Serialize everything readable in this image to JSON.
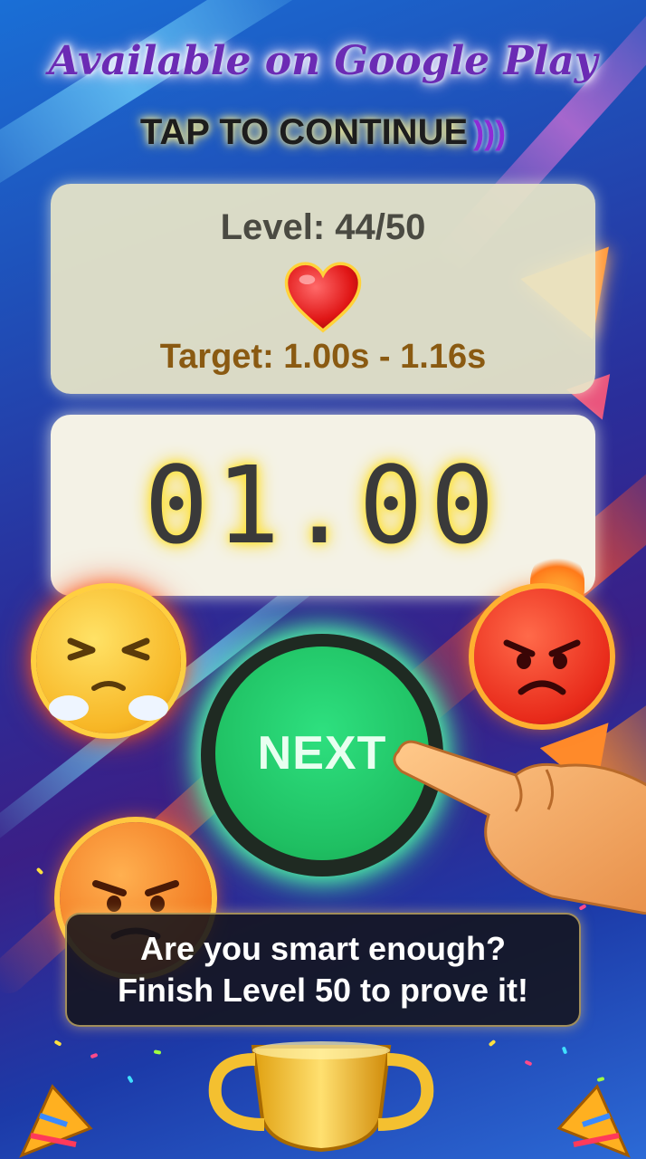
{
  "banner": {
    "headline": "Available on Google Play",
    "tap_prompt": "TAP TO CONTINUE",
    "tap_icon": "sound-waves-icon"
  },
  "level_panel": {
    "level_text": "Level: 44/50",
    "life_icon": "heart-icon",
    "target_text": "Target: 1.00s - 1.16s"
  },
  "timer": {
    "value": "01.00"
  },
  "action": {
    "next_label": "NEXT"
  },
  "promo": {
    "line1": "Are you smart enough?",
    "line2": "Finish Level 50 to prove it!"
  },
  "decorations": {
    "emojis": [
      "huffing-emoji",
      "angry-fire-emoji",
      "grumpy-emoji"
    ],
    "hand_icon": "pointing-hand-icon",
    "trophy_icon": "trophy-icon",
    "popper_icon": "party-popper-icon"
  },
  "colors": {
    "button_green": "#1fbf62",
    "target_text": "#8a5a12",
    "headline_purple": "#6b2bb4"
  }
}
